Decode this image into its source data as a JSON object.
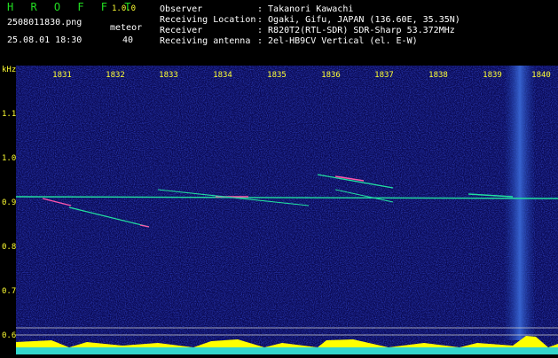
{
  "header": {
    "app_name": "H R O F F T",
    "app_version": "1.0.0",
    "filename": "2508011830.png",
    "datetime": "25.08.01 18:30",
    "meteor_label": "meteor",
    "meteor_count": "40",
    "observer_label": "Observer",
    "observer_value": ": Takanori Kawachi",
    "location_label": "Receiving Location",
    "location_value": ": Ogaki, Gifu, JAPAN (136.60E, 35.35N)",
    "receiver_label": "Receiver",
    "receiver_value": ": R820T2(RTL-SDR) SDR-Sharp 53.372MHz",
    "antenna_label": "Receiving antenna",
    "antenna_value": ": 2el-HB9CV Vertical (el. E-W)"
  },
  "spectrogram": {
    "unit_label": "kHz",
    "y_ticks": [
      "1.1",
      "1.0",
      "0.9",
      "0.8",
      "0.7",
      "0.6"
    ],
    "x_ticks": [
      "1831",
      "1832",
      "1833",
      "1834",
      "1835",
      "1836",
      "1837",
      "1838",
      "1839",
      "1840"
    ],
    "colors": {
      "background": "#0a0a55",
      "signal": "#22e0a0",
      "strong": "#ff55aa",
      "tick": "#ffff33",
      "histogram": "#ffff00",
      "baseline": "#00ccff"
    }
  }
}
